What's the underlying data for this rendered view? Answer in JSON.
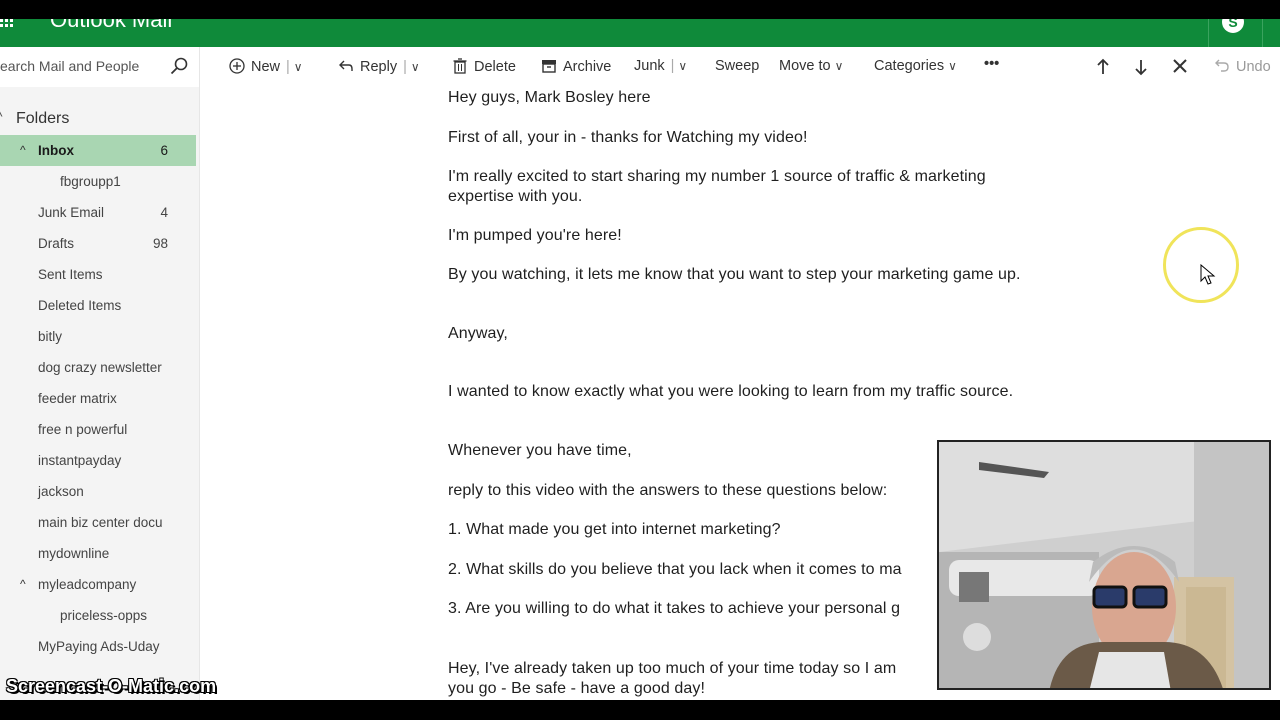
{
  "header": {
    "app_title": "Outlook Mail",
    "skype_label": "S"
  },
  "search": {
    "placeholder": "earch Mail and People"
  },
  "folders": {
    "heading": "Folders",
    "items": [
      {
        "label": "Inbox",
        "count": "6"
      },
      {
        "label": "fbgroupp1",
        "count": ""
      },
      {
        "label": "Junk Email",
        "count": "4"
      },
      {
        "label": "Drafts",
        "count": "98"
      },
      {
        "label": "Sent Items",
        "count": ""
      },
      {
        "label": "Deleted Items",
        "count": ""
      },
      {
        "label": "bitly",
        "count": ""
      },
      {
        "label": "dog crazy newsletter",
        "count": ""
      },
      {
        "label": "feeder matrix",
        "count": ""
      },
      {
        "label": "free n powerful",
        "count": ""
      },
      {
        "label": "instantpayday",
        "count": ""
      },
      {
        "label": "jackson",
        "count": ""
      },
      {
        "label": "main biz center docu",
        "count": ""
      },
      {
        "label": "mydownline",
        "count": ""
      },
      {
        "label": "myleadcompany",
        "count": ""
      },
      {
        "label": "priceless-opps",
        "count": ""
      },
      {
        "label": "MyPaying Ads-Uday",
        "count": ""
      }
    ]
  },
  "toolbar": {
    "new_label": "New",
    "reply_label": "Reply",
    "delete_label": "Delete",
    "archive_label": "Archive",
    "junk_label": "Junk",
    "sweep_label": "Sweep",
    "move_to_label": "Move to",
    "categories_label": "Categories",
    "more_label": "•••",
    "undo_label": "Undo"
  },
  "message": {
    "lines": [
      "Hey guys, Mark Bosley here",
      "First of all, your in - thanks for Watching my video!",
      "I'm really excited to start sharing my number 1 source of traffic & marketing expertise with you.",
      "I'm pumped you're here!",
      "By you watching, it lets me know that you want to step your marketing game up.",
      "Anyway,",
      "I wanted to know exactly what you were looking to learn from my traffic source.",
      "Whenever you have time,",
      "reply to this video with the answers to these questions below:",
      "1. What made you get into internet marketing?",
      "2. What skills do you believe that you lack when it comes to ma",
      "3. Are you willing to do what it takes to achieve your personal g",
      "Hey, I've already taken up too much of your time today so I am",
      "you go - Be safe - have a good day!"
    ]
  },
  "overlay": {
    "watermark": "Screencast-O-Matic.com"
  },
  "colors": {
    "brand_green": "#0f8a3a",
    "active_folder": "#a9d6b2",
    "cursor_ring": "#f0e45a"
  }
}
